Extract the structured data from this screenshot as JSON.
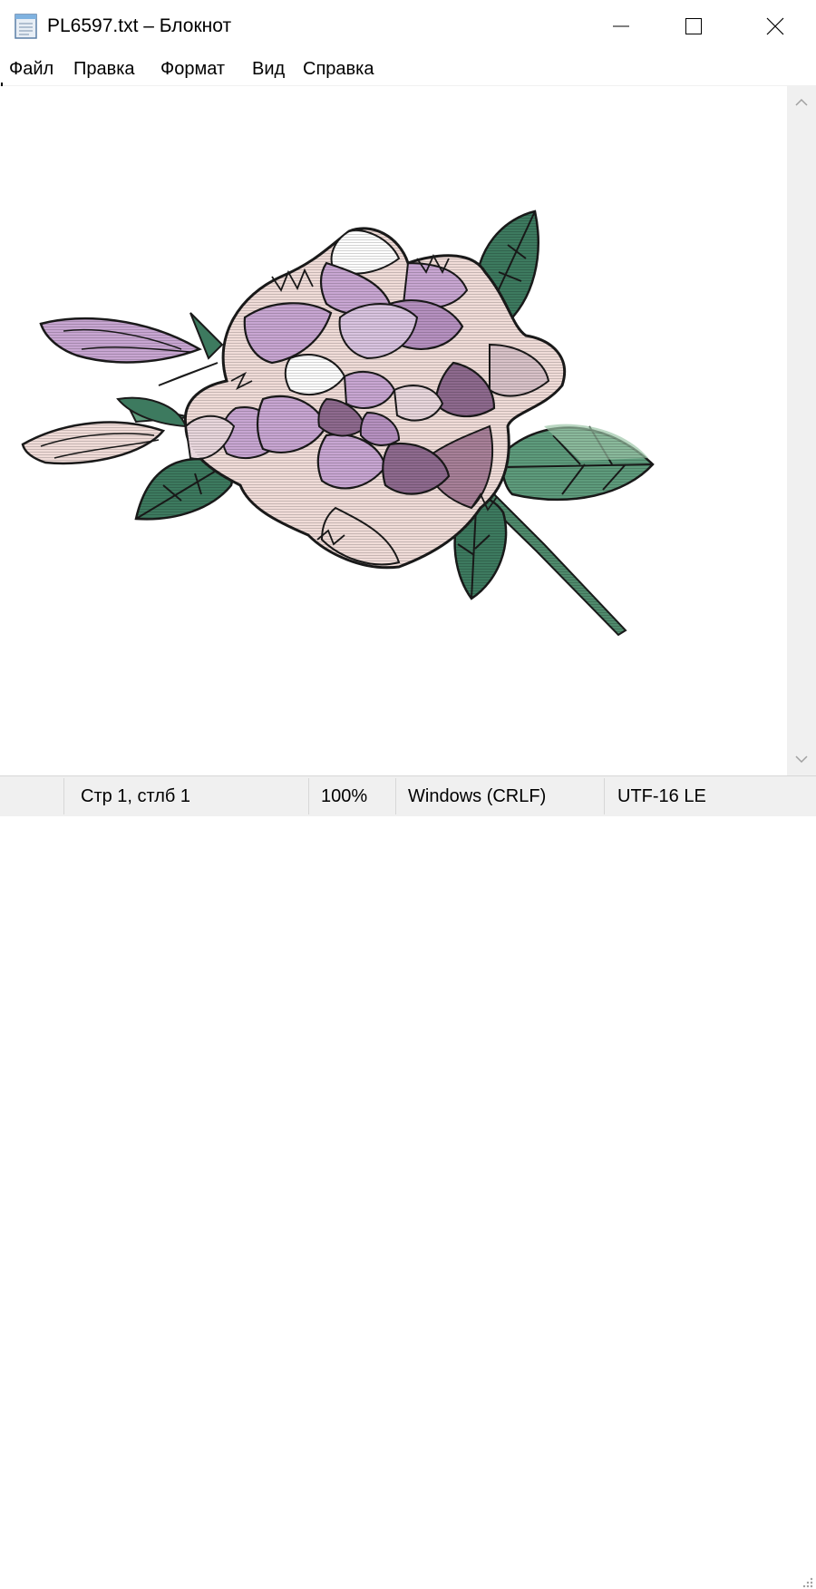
{
  "window": {
    "title": "PL6597.txt – Блокнот",
    "icon": "notepad-icon",
    "controls": [
      "minimize-icon",
      "maximize-icon",
      "close-icon"
    ]
  },
  "menu": {
    "file": "Файл",
    "edit": "Правка",
    "format": "Формат",
    "view": "Вид",
    "help": "Справка"
  },
  "editor": {
    "content_image": "flower-illustration",
    "colors": {
      "petal_lilac": "#c8a6d2",
      "petal_dark": "#8e6a8e",
      "petal_blush": "#f0dcd8",
      "leaf_green": "#3d7a5f",
      "leaf_light": "#9cc6a8",
      "outline": "#1a1a1a"
    }
  },
  "statusbar": {
    "position": "Стр 1, стлб 1",
    "zoom": "100%",
    "line_endings": "Windows (CRLF)",
    "encoding": "UTF-16 LE"
  }
}
